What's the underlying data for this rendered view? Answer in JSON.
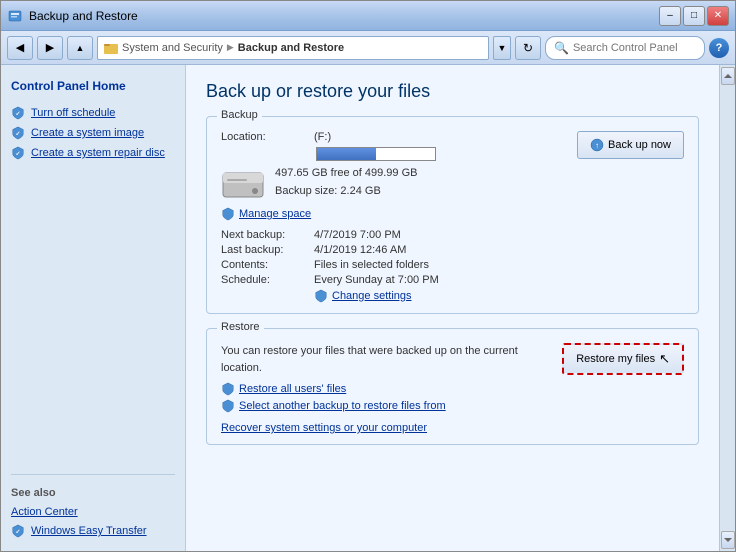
{
  "window": {
    "title": "Backup and Restore",
    "minimize_label": "–",
    "restore_label": "□",
    "close_label": "✕"
  },
  "addressbar": {
    "back_tooltip": "Back",
    "forward_tooltip": "Forward",
    "path": {
      "part1": "System and Security",
      "arrow1": "▶",
      "part2": "Backup and Restore"
    },
    "search_placeholder": "Search Control Panel",
    "help_label": "?"
  },
  "sidebar": {
    "home_label": "Control Panel Home",
    "items": [
      {
        "label": "Turn off schedule",
        "id": "turn-off-schedule"
      },
      {
        "label": "Create a system image",
        "id": "create-system-image"
      },
      {
        "label": "Create a system repair disc",
        "id": "create-system-repair-disc"
      }
    ],
    "see_also_label": "See also",
    "bottom_items": [
      {
        "label": "Action Center",
        "id": "action-center"
      },
      {
        "label": "Windows Easy Transfer",
        "id": "windows-easy-transfer"
      }
    ]
  },
  "content": {
    "page_title": "Back up or restore your files",
    "backup_section_label": "Backup",
    "location_label": "Location:",
    "location_value": "(F:)",
    "disk_free": "497.65 GB free of 499.99 GB",
    "backup_size": "Backup size: 2.24 GB",
    "manage_space_label": "Manage space",
    "next_backup_label": "Next backup:",
    "next_backup_value": "4/7/2019 7:00 PM",
    "last_backup_label": "Last backup:",
    "last_backup_value": "4/1/2019 12:46 AM",
    "contents_label": "Contents:",
    "contents_value": "Files in selected folders",
    "schedule_label": "Schedule:",
    "schedule_value": "Every Sunday at 7:00 PM",
    "change_settings_label": "Change settings",
    "back_up_now_label": "Back up now",
    "restore_section_label": "Restore",
    "restore_description": "You can restore your files that were backed up on the current location.",
    "restore_my_files_label": "Restore my files",
    "restore_all_users_label": "Restore all users' files",
    "select_another_backup_label": "Select another backup to restore files from",
    "recover_system_label": "Recover system settings or your computer"
  }
}
